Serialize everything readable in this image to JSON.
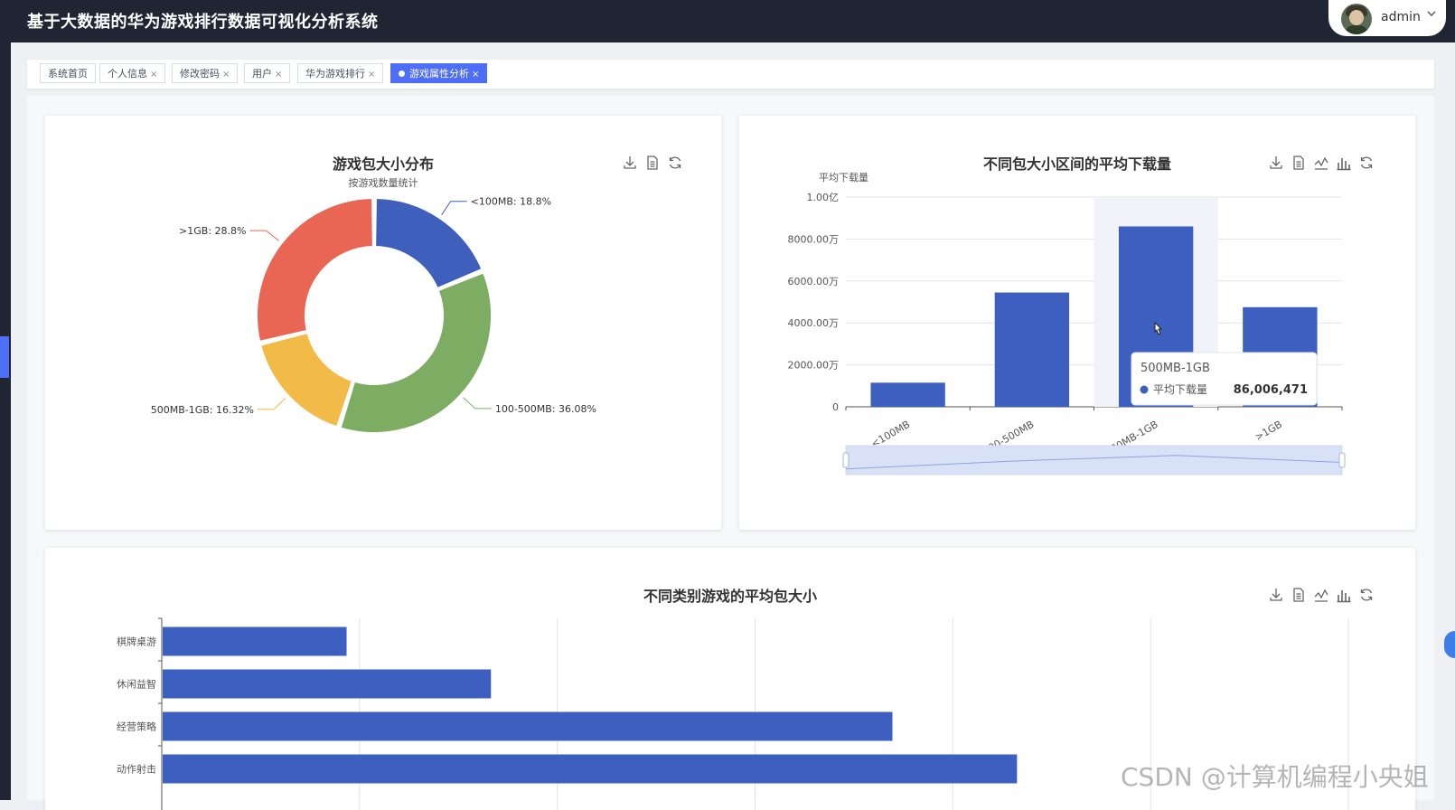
{
  "header": {
    "title": "基于大数据的华为游戏排行数据可视化分析系统",
    "user": "admin"
  },
  "tabs": [
    {
      "label": "系统首页",
      "closable": false,
      "active": false
    },
    {
      "label": "个人信息",
      "closable": true,
      "active": false
    },
    {
      "label": "修改密码",
      "closable": true,
      "active": false
    },
    {
      "label": "用户",
      "closable": true,
      "active": false
    },
    {
      "label": "华为游戏排行",
      "closable": true,
      "active": false
    },
    {
      "label": "游戏属性分析",
      "closable": true,
      "active": true
    }
  ],
  "tab_close_symbol": "×",
  "colors": {
    "accent": "#4f6ef7",
    "bar": "#3d5fc0",
    "header": "#1f2533"
  },
  "icons": [
    "download-icon",
    "data-view-icon",
    "line-switch-icon",
    "bar-switch-icon",
    "restore-icon"
  ],
  "chart_data": [
    {
      "type": "pie",
      "variant": "donut",
      "title": "游戏包大小分布",
      "subtitle": "按游戏数量统计",
      "slices": [
        {
          "name": "<100MB",
          "value": 18.8,
          "label": "<100MB: 18.8%",
          "color": "#3f5fbd"
        },
        {
          "name": "100-500MB",
          "value": 36.08,
          "label": "100-500MB: 36.08%",
          "color": "#7dad62"
        },
        {
          "name": "500MB-1GB",
          "value": 16.32,
          "label": "500MB-1GB: 16.32%",
          "color": "#f2bb47"
        },
        {
          "name": ">1GB",
          "value": 28.8,
          "label": ">1GB: 28.8%",
          "color": "#e96655"
        }
      ]
    },
    {
      "type": "bar",
      "title": "不同包大小区间的平均下载量",
      "ylabel": "平均下载量",
      "categories": [
        "<100MB",
        "100-500MB",
        "500MB-1GB",
        ">1GB"
      ],
      "values": [
        11500000,
        54500000,
        86006471,
        47500000
      ],
      "ylim": [
        0,
        100000000
      ],
      "yticks": [
        {
          "value": 0,
          "label": "0"
        },
        {
          "value": 20000000,
          "label": "2000.00万"
        },
        {
          "value": 40000000,
          "label": "4000.00万"
        },
        {
          "value": 60000000,
          "label": "6000.00万"
        },
        {
          "value": 80000000,
          "label": "8000.00万"
        },
        {
          "value": 100000000,
          "label": "1.00亿"
        }
      ],
      "highlighted_category": "500MB-1GB",
      "tooltip": {
        "category": "500MB-1GB",
        "series": "平均下载量",
        "value": "86,006,471"
      },
      "grid": true,
      "datazoom": {
        "start": 0,
        "end": 100
      }
    },
    {
      "type": "bar",
      "orientation": "horizontal",
      "title": "不同类别游戏的平均包大小",
      "categories": [
        "棋牌桌游",
        "休闲益智",
        "经营策略",
        "动作射击"
      ],
      "values": [
        0.93,
        1.66,
        3.69,
        4.32
      ],
      "xlim": [
        0,
        6
      ],
      "grid": true
    }
  ],
  "watermark": "CSDN @计算机编程小央姐"
}
